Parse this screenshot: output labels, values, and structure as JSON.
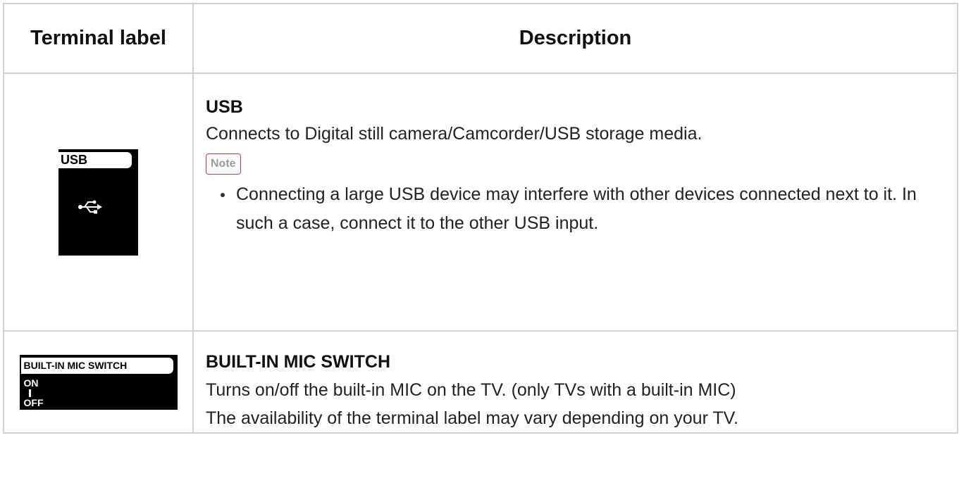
{
  "table": {
    "header": {
      "label_col": "Terminal label",
      "desc_col": "Description"
    },
    "rows": [
      {
        "graphic": {
          "tag_text": "USB",
          "icon": "usb-trident-icon"
        },
        "title": "USB",
        "description": "Connects to Digital still camera/Camcorder/USB storage media.",
        "note_label": "Note",
        "notes": [
          "Connecting a large USB device may interfere with other devices connected next to it. In such a case, connect it to the other USB input."
        ]
      },
      {
        "graphic": {
          "tag_text": "BUILT-IN MIC SWITCH",
          "on_text": "ON",
          "off_text": "OFF"
        },
        "title": "BUILT-IN MIC SWITCH",
        "description_lines": [
          "Turns on/off the built-in MIC on the TV. (only TVs with a built-in MIC)",
          "The availability of the terminal label may vary depending on your TV."
        ]
      }
    ]
  },
  "colors": {
    "border": "#d0d0d0",
    "note_border": "#c7373b",
    "note_text": "#9a9a9a",
    "graphic_bg": "#000000"
  }
}
